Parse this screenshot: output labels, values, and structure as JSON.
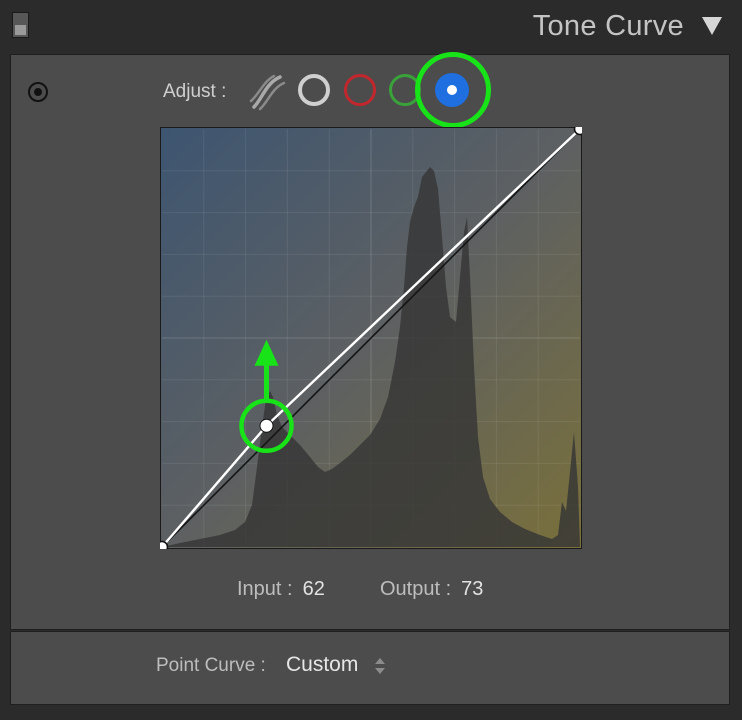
{
  "header": {
    "title": "Tone Curve"
  },
  "adjust": {
    "label": "Adjust :",
    "channels": [
      "parametric",
      "rgb",
      "red",
      "green",
      "blue"
    ],
    "selected": "blue"
  },
  "readout": {
    "input_label": "Input :",
    "input_value": "62",
    "output_label": "Output :",
    "output_value": "73"
  },
  "point_curve": {
    "label": "Point Curve :",
    "value": "Custom"
  },
  "colors": {
    "highlight": "#18e218",
    "blue_channel": "#1f6fe0",
    "red_channel": "#c1272d",
    "green_channel": "#3aa23a"
  },
  "chart_data": {
    "type": "line",
    "series": [
      {
        "values": [
          [
            0,
            0
          ],
          [
            25,
            29
          ],
          [
            100,
            100
          ]
        ]
      },
      {
        "values": [
          [
            0,
            0
          ],
          [
            100,
            100
          ]
        ]
      }
    ],
    "xlim": [
      0,
      100
    ],
    "ylim": [
      0,
      100
    ],
    "grid": true,
    "control_points": [
      [
        0,
        0
      ],
      [
        25,
        29
      ],
      [
        100,
        100
      ]
    ],
    "selected_point": [
      25,
      29
    ]
  }
}
